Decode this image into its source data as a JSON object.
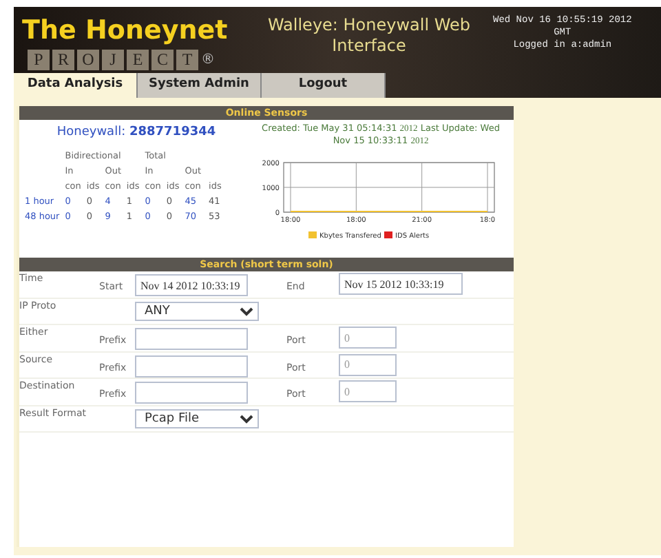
{
  "header": {
    "logo_title": "The Honeynet",
    "logo_letters": [
      "P",
      "R",
      "O",
      "J",
      "E",
      "C",
      "T"
    ],
    "logo_mark": "®",
    "title": "Walleye: Honeywall Web Interface",
    "datetime": "Wed Nov 16 10:55:19 2012",
    "timezone": "GMT",
    "login": "Logged in a:admin"
  },
  "tabs": [
    {
      "label": "Data Analysis",
      "selected": true
    },
    {
      "label": "System Admin",
      "selected": false
    },
    {
      "label": "Logout",
      "selected": false
    }
  ],
  "online_sensors": {
    "title": "Online Sensors",
    "honeywall_label": "Honeywall:",
    "honeywall_id": "2887719344",
    "created": "Created: Tue May 31 05:14:31",
    "created_year": "2012",
    "last_update": "Last Update: Wed",
    "last_update_date": "Nov 15 10:33:11",
    "last_update_year": "2012",
    "group_headers": [
      "Bidirectional",
      "Total"
    ],
    "dir_headers": [
      "In",
      "Out",
      "In",
      "Out"
    ],
    "col_headers": [
      "con",
      "ids",
      "con",
      "ids",
      "con",
      "ids",
      "con",
      "ids"
    ],
    "rows": [
      {
        "label": "1 hour",
        "values": [
          "0",
          "0",
          "4",
          "1",
          "0",
          "0",
          "45",
          "41"
        ]
      },
      {
        "label": "48 hour",
        "values": [
          "0",
          "0",
          "9",
          "1",
          "0",
          "0",
          "70",
          "53"
        ]
      }
    ],
    "chart_data": {
      "type": "line",
      "grid": true,
      "legend": "bottom",
      "categories": [
        "18:00",
        "18:00",
        "21:00",
        "18:0"
      ],
      "yticks": [
        0,
        1000,
        2000
      ],
      "ylim": [
        0,
        2000
      ],
      "series": [
        {
          "name": "Kbytes Transfered",
          "color": "#f2c230",
          "values": [
            0,
            0,
            0,
            0
          ]
        },
        {
          "name": "IDS Alerts",
          "color": "#e02020",
          "values": [
            null,
            null,
            null,
            null
          ]
        }
      ]
    }
  },
  "search": {
    "title": "Search (short term soln)",
    "rows": [
      {
        "kind": "time",
        "label": "Time",
        "sub": "Start",
        "value": "Nov 14 2012 10:33:19",
        "sub2": "End",
        "value2": "Nov 15 2012 10:33:19"
      },
      {
        "kind": "select",
        "label": "IP Proto",
        "value": "ANY"
      },
      {
        "kind": "prefix",
        "label": "Either",
        "sub": "Prefix",
        "sub2": "Port",
        "value2": "0"
      },
      {
        "kind": "prefix",
        "label": "Source",
        "sub": "Prefix",
        "sub2": "Port",
        "value2": "0"
      },
      {
        "kind": "prefix",
        "label": "Destination",
        "sub": "Prefix",
        "sub2": "Port",
        "value2": "0"
      },
      {
        "kind": "select",
        "label": "Result Format",
        "value": "Pcap File"
      }
    ]
  }
}
